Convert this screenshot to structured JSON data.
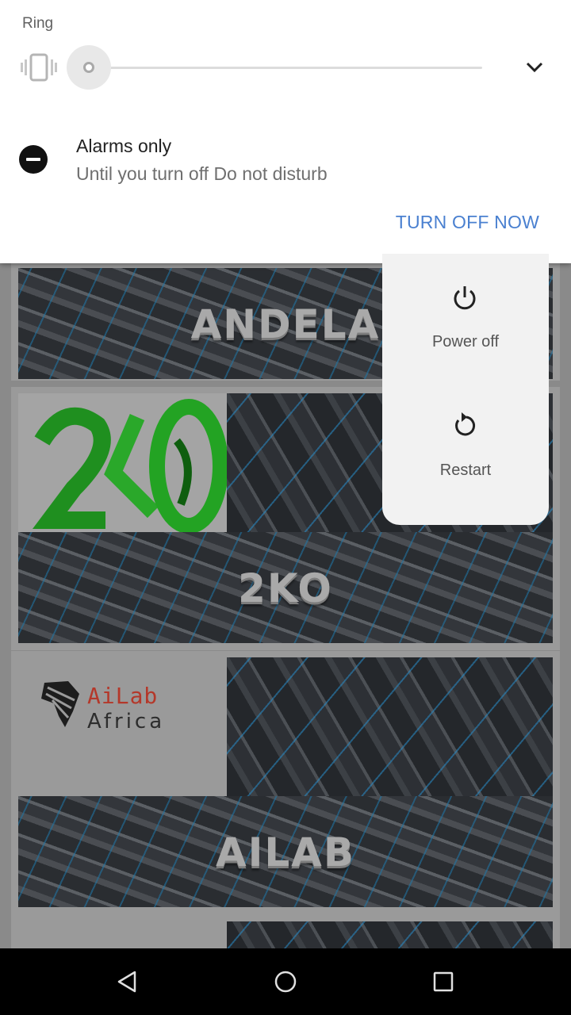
{
  "shade": {
    "ring_label": "Ring",
    "volume_percent": 0,
    "dnd_title": "Alarms only",
    "dnd_subtitle": "Until you turn off Do not disturb",
    "turn_off_label": "TURN OFF NOW",
    "accent_color": "#4a80d0"
  },
  "power_menu": {
    "items": [
      {
        "label": "Power off",
        "icon": "power-icon"
      },
      {
        "label": "Restart",
        "icon": "restart-icon"
      }
    ]
  },
  "app": {
    "cards": [
      {
        "title": "ANDELA"
      },
      {
        "title": "2KO",
        "logo_text": "2KO"
      },
      {
        "title": "AILAB",
        "logo_line1": "AiLab",
        "logo_line2": "Africa"
      }
    ]
  },
  "navbar": {
    "buttons": [
      "back-icon",
      "home-icon",
      "recents-icon"
    ]
  }
}
